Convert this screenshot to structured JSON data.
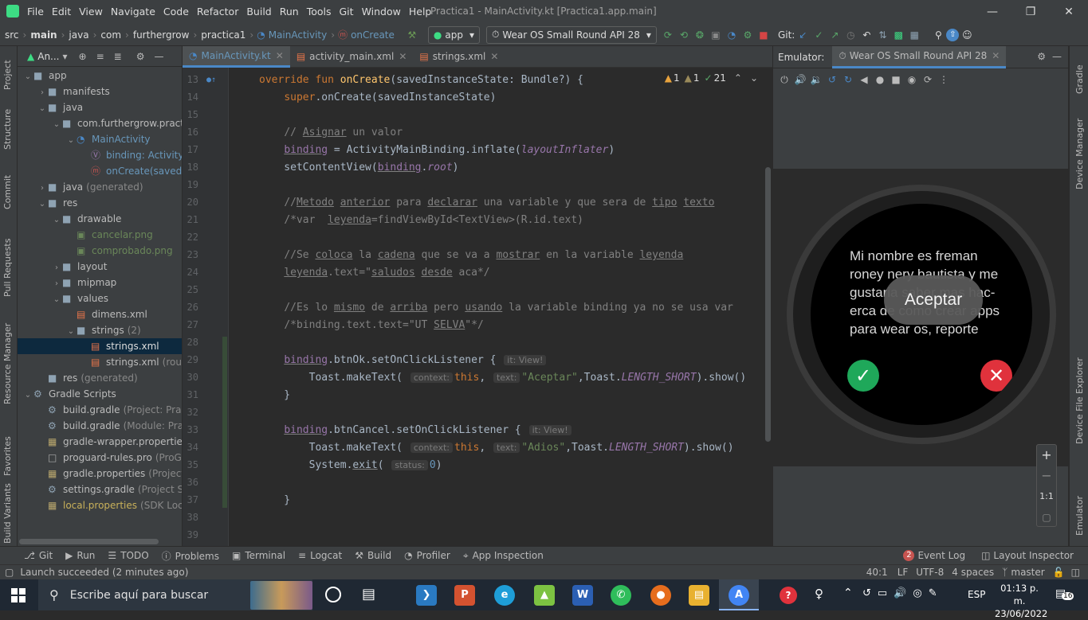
{
  "titlebar": {
    "menu": [
      "File",
      "Edit",
      "View",
      "Navigate",
      "Code",
      "Refactor",
      "Build",
      "Run",
      "Tools",
      "Git",
      "Window",
      "Help"
    ],
    "title": "Practica1 - MainActivity.kt [Practica1.app.main]"
  },
  "navbar": {
    "breadcrumbs": [
      "src",
      "main",
      "java",
      "com",
      "furthergrow",
      "practica1",
      "MainActivity",
      "onCreate"
    ],
    "run_config": "app",
    "device": "Wear OS Small Round API 28",
    "git_label": "Git:"
  },
  "left_stripe": [
    "Project",
    "Structure",
    "Commit",
    "Pull Requests",
    "Resource Manager",
    "Favorites",
    "Build Variants"
  ],
  "project": {
    "header": "An...",
    "tree": [
      {
        "label": "app",
        "level": 0,
        "open": true,
        "icon": "folder"
      },
      {
        "label": "manifests",
        "level": 1,
        "open": false,
        "icon": "folder"
      },
      {
        "label": "java",
        "level": 1,
        "open": true,
        "icon": "folder"
      },
      {
        "label": "com.furthergrow.practic",
        "level": 2,
        "open": true,
        "icon": "package"
      },
      {
        "label": "MainActivity",
        "level": 3,
        "open": true,
        "icon": "class",
        "accent": "blue"
      },
      {
        "label": "binding: ActivityM",
        "level": 4,
        "icon": "property",
        "accent": "blue"
      },
      {
        "label": "onCreate(savedIn",
        "level": 4,
        "icon": "method",
        "accent": "blue"
      },
      {
        "label": "java",
        "suffix": "(generated)",
        "level": 1,
        "open": false,
        "icon": "folder"
      },
      {
        "label": "res",
        "level": 1,
        "open": true,
        "icon": "folder"
      },
      {
        "label": "drawable",
        "level": 2,
        "open": true,
        "icon": "folder"
      },
      {
        "label": "cancelar.png",
        "level": 3,
        "icon": "image",
        "accent": "green"
      },
      {
        "label": "comprobado.png",
        "level": 3,
        "icon": "image",
        "accent": "green"
      },
      {
        "label": "layout",
        "level": 2,
        "open": false,
        "icon": "folder"
      },
      {
        "label": "mipmap",
        "level": 2,
        "open": false,
        "icon": "folder"
      },
      {
        "label": "values",
        "level": 2,
        "open": true,
        "icon": "folder"
      },
      {
        "label": "dimens.xml",
        "level": 3,
        "icon": "xml"
      },
      {
        "label": "strings",
        "suffix": "(2)",
        "level": 3,
        "open": true,
        "icon": "folder"
      },
      {
        "label": "strings.xml",
        "level": 4,
        "icon": "xml",
        "selected": true
      },
      {
        "label": "strings.xml",
        "suffix": "(roun",
        "level": 4,
        "icon": "xml"
      },
      {
        "label": "res",
        "suffix": "(generated)",
        "level": 1,
        "icon": "folder"
      },
      {
        "label": "Gradle Scripts",
        "level": 0,
        "open": true,
        "icon": "gradle"
      },
      {
        "label": "build.gradle",
        "suffix": "(Project: Practi",
        "level": 1,
        "icon": "gradle"
      },
      {
        "label": "build.gradle",
        "suffix": "(Module: Pract",
        "level": 1,
        "icon": "gradle"
      },
      {
        "label": "gradle-wrapper.properties",
        "suffix": "(",
        "level": 1,
        "icon": "props"
      },
      {
        "label": "proguard-rules.pro",
        "suffix": "(ProGua",
        "level": 1,
        "icon": "file"
      },
      {
        "label": "gradle.properties",
        "suffix": "(Project Pr",
        "level": 1,
        "icon": "props"
      },
      {
        "label": "settings.gradle",
        "suffix": "(Project Sett",
        "level": 1,
        "icon": "gradle"
      },
      {
        "label": "local.properties",
        "suffix": "(SDK Locati",
        "level": 1,
        "icon": "props",
        "accent": "yellow"
      }
    ]
  },
  "tabs": [
    {
      "label": "MainActivity.kt",
      "active": true
    },
    {
      "label": "activity_main.xml",
      "active": false
    },
    {
      "label": "strings.xml",
      "active": false
    }
  ],
  "inspections": {
    "warn1": "1",
    "warn2": "1",
    "ok": "21"
  },
  "code": [
    {
      "n": "13",
      "html": "<span class='kw'>override fun </span><span class='fn'>onCreate</span>(savedInstanceState: Bundle?) {"
    },
    {
      "n": "14",
      "html": "    <span class='kw'>super</span>.onCreate(savedInstanceState)"
    },
    {
      "n": "15",
      "html": ""
    },
    {
      "n": "16",
      "html": "    <span class='cm'>// <span class='ul'>Asignar</span> un valor</span>"
    },
    {
      "n": "17",
      "html": "    <span class='it ul' style='font-style:normal'>binding</span> = ActivityMainBinding.inflate(<span class='it'>layoutInflater</span>)"
    },
    {
      "n": "18",
      "html": "    setContentView(<span class='it ul' style='font-style:normal'>binding</span>.<span class='it'>root</span>)"
    },
    {
      "n": "19",
      "html": ""
    },
    {
      "n": "20",
      "html": "    <span class='cm'>//<span class='ul'>Metodo</span> <span class='ul'>anterior</span> para <span class='ul'>declarar</span> una variable y que sera de <span class='ul'>tipo</span> <span class='ul'>texto</span></span>"
    },
    {
      "n": "21",
      "html": "    <span class='cm'>/*var  <span class='ul'>leyenda</span>=findViewById&lt;TextView&gt;(R.id.text)</span>"
    },
    {
      "n": "22",
      "html": ""
    },
    {
      "n": "23",
      "html": "    <span class='cm'>//Se <span class='ul'>coloca</span> la <span class='ul'>cadena</span> que se va a <span class='ul'>mostrar</span> en la variable <span class='ul'>leyenda</span></span>"
    },
    {
      "n": "24",
      "html": "    <span class='cm'><span class='ul'>leyenda</span>.text=\"<span class='ul'>saludos</span> <span class='ul'>desde</span> aca*/</span>"
    },
    {
      "n": "25",
      "html": ""
    },
    {
      "n": "26",
      "html": "    <span class='cm'>//Es lo <span class='ul'>mismo</span> de <span class='ul'>arriba</span> pero <span class='ul'>usando</span> la variable binding ya no se usa var</span>"
    },
    {
      "n": "27",
      "html": "    <span class='cm'>/*binding.text.text=\"UT <span class='ul'>SELVA</span>\"*/</span>"
    },
    {
      "n": "28",
      "html": ""
    },
    {
      "n": "29",
      "html": "    <span class='it ul' style='font-style:normal;color:#9876aa'>binding</span>.btnOk.setOnClickListener { <span class='hint'>it: View!</span>"
    },
    {
      "n": "30",
      "html": "        Toast.makeText( <span class='hint'>context:</span><span class='kw'>this</span>, <span class='hint'>text:</span><span class='str'>\"Aceptar\"</span>,Toast.<span class='it'>LENGTH_SHORT</span>).show()"
    },
    {
      "n": "31",
      "html": "    }"
    },
    {
      "n": "32",
      "html": ""
    },
    {
      "n": "33",
      "html": "    <span class='it ul' style='font-style:normal;color:#9876aa'>binding</span>.btnCancel.setOnClickListener { <span class='hint'>it: View!</span>"
    },
    {
      "n": "34",
      "html": "        Toast.makeText( <span class='hint'>context:</span><span class='kw'>this</span>, <span class='hint'>text:</span><span class='str'>\"Adios\"</span>,Toast.<span class='it'>LENGTH_SHORT</span>).show()"
    },
    {
      "n": "35",
      "html": "        System.<span class='ul'>exit</span>( <span class='hint'>status:</span><span class='blue'>0</span>)"
    },
    {
      "n": "36",
      "html": ""
    },
    {
      "n": "37",
      "html": "    }"
    },
    {
      "n": "38",
      "html": ""
    },
    {
      "n": "39",
      "html": ""
    }
  ],
  "emulator": {
    "label": "Emulator:",
    "tab": "Wear OS Small Round API 28",
    "watch_text": "Mi nombre es freman roney nery bautista y me gustaria saber mas hac-erca de como crear apps para wear os, reporte",
    "toast": "Aceptar",
    "zoom": [
      "+",
      "−",
      "1:1"
    ]
  },
  "right_stripe": [
    "Gradle",
    "Device Manager",
    "Device File Explorer",
    "Emulator"
  ],
  "toolwindows": [
    "Git",
    "Run",
    "TODO",
    "Problems",
    "Terminal",
    "Logcat",
    "Build",
    "Profiler",
    "App Inspection"
  ],
  "toolwindows_right": {
    "event_count": "2",
    "event_log": "Event Log",
    "layout_inspector": "Layout Inspector"
  },
  "status": {
    "message": "Launch succeeded (2 minutes ago)",
    "position": "40:1",
    "line_sep": "LF",
    "encoding": "UTF-8",
    "indent": "4 spaces",
    "branch": "master"
  },
  "taskbar": {
    "search_placeholder": "Escribe aquí para buscar",
    "lang": "ESP",
    "time": "01:13 p. m.",
    "date": "23/06/2022",
    "notif_count": "16"
  },
  "colors": {
    "accent": "#4a88c7",
    "ok_green": "#1fa85a",
    "cancel_red": "#e0323c"
  }
}
